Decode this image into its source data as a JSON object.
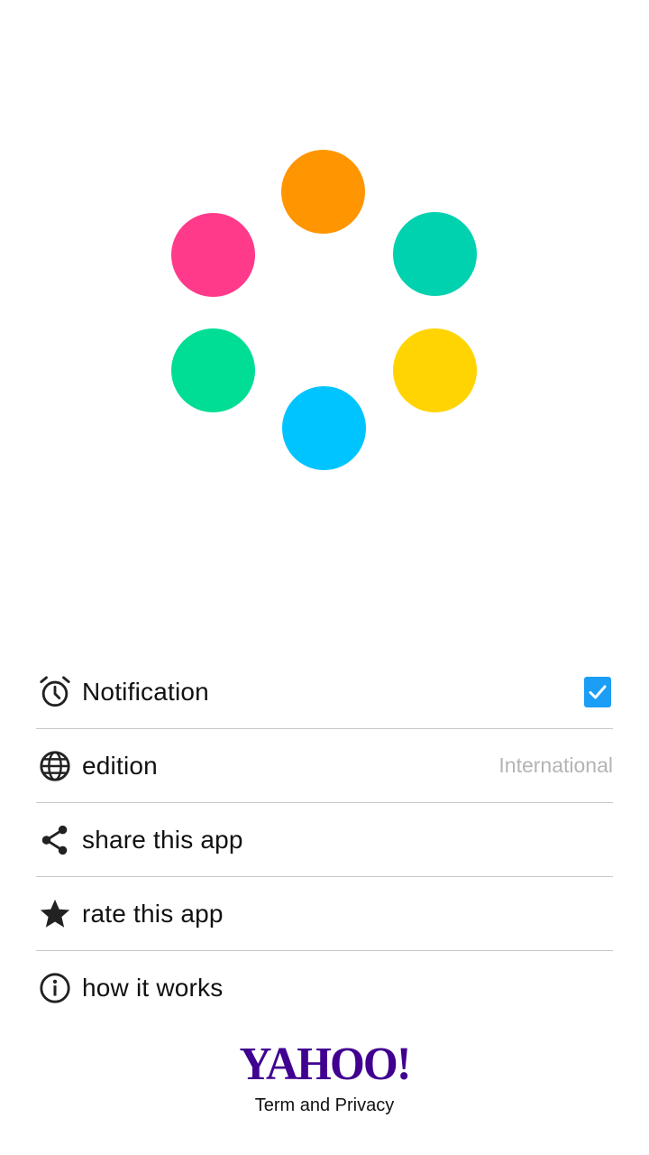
{
  "logo": {
    "dots": [
      {
        "name": "orange-dot",
        "color": "#FF9500"
      },
      {
        "name": "teal-dot",
        "color": "#00D1AE"
      },
      {
        "name": "yellow-dot",
        "color": "#FFD400"
      },
      {
        "name": "blue-dot",
        "color": "#00C4FF"
      },
      {
        "name": "green-dot",
        "color": "#00DD94"
      },
      {
        "name": "pink-dot",
        "color": "#FF3A8A"
      }
    ]
  },
  "menu": {
    "notification": {
      "label": "Notification",
      "icon": "alarm-clock-icon",
      "checked": true,
      "checkbox_color": "#1A9EF6"
    },
    "edition": {
      "label": "edition",
      "value": "International",
      "icon": "globe-icon"
    },
    "share": {
      "label": "share this app",
      "icon": "share-icon"
    },
    "rate": {
      "label": "rate this app",
      "icon": "star-icon"
    },
    "how": {
      "label": "how it works",
      "icon": "info-icon"
    }
  },
  "footer": {
    "brand": "YAHOO!",
    "brand_color": "#400090",
    "terms": "Term and Privacy"
  }
}
